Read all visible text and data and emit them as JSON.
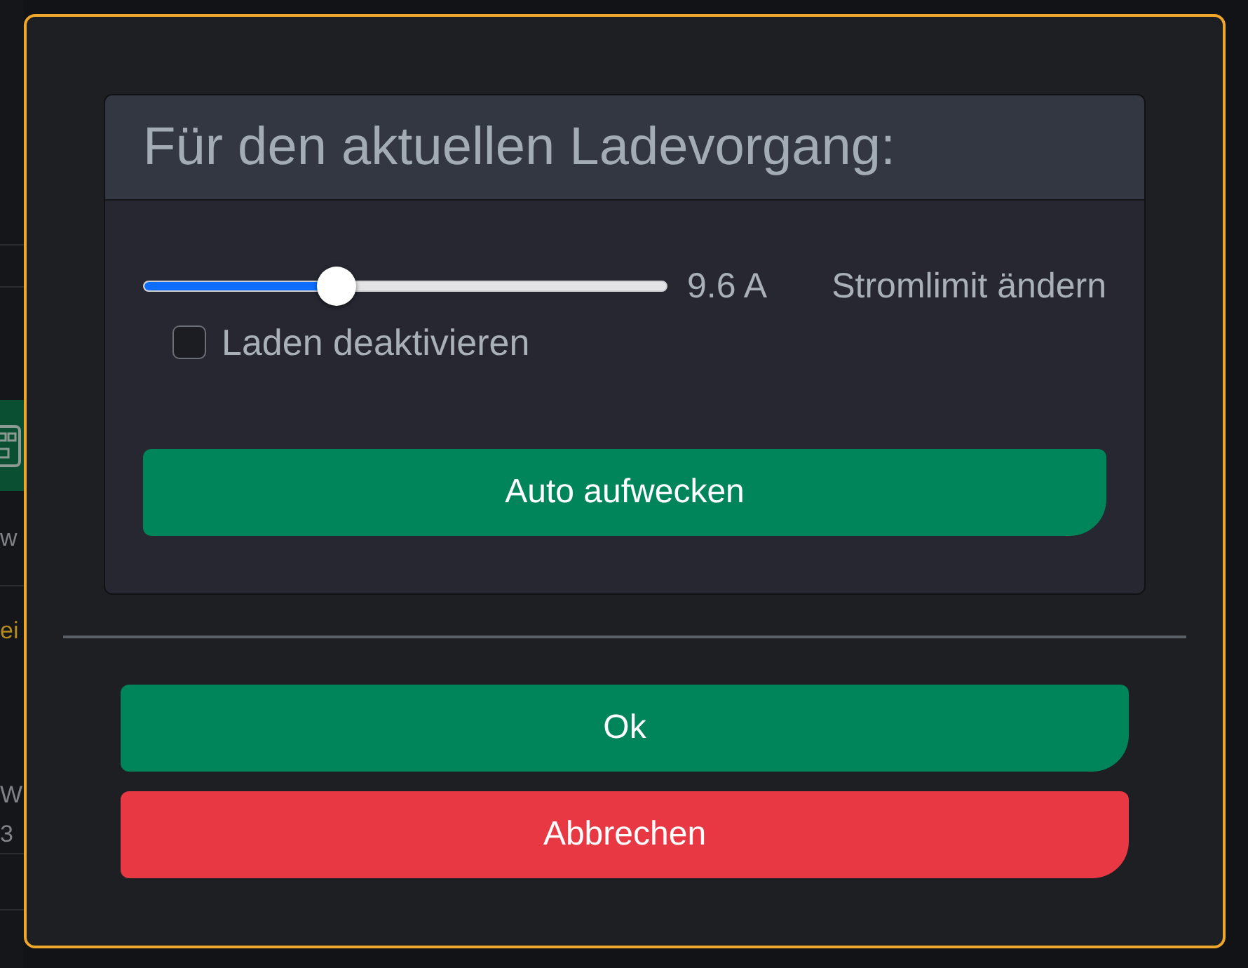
{
  "background": {
    "texts": [
      {
        "text": "w",
        "color": "#7f8286"
      },
      {
        "text": "ei",
        "color": "#b48a1a"
      },
      {
        "text": "W",
        "color": "#7f8286"
      },
      {
        "text": "3",
        "color": "#7f8286"
      }
    ]
  },
  "dialog": {
    "card": {
      "title": "Für den aktuellen Ladevorgang:",
      "slider": {
        "level": 0.37,
        "reading": "9.6 A",
        "label": "Stromlimit ändern"
      },
      "checkbox": {
        "label": "Laden deaktivieren",
        "checked": false
      },
      "button": "Auto aufwecken"
    },
    "buttons": [
      {
        "label": "Ok",
        "kind": "confirm"
      },
      {
        "label": "Abbrechen",
        "kind": "cancel"
      }
    ]
  }
}
